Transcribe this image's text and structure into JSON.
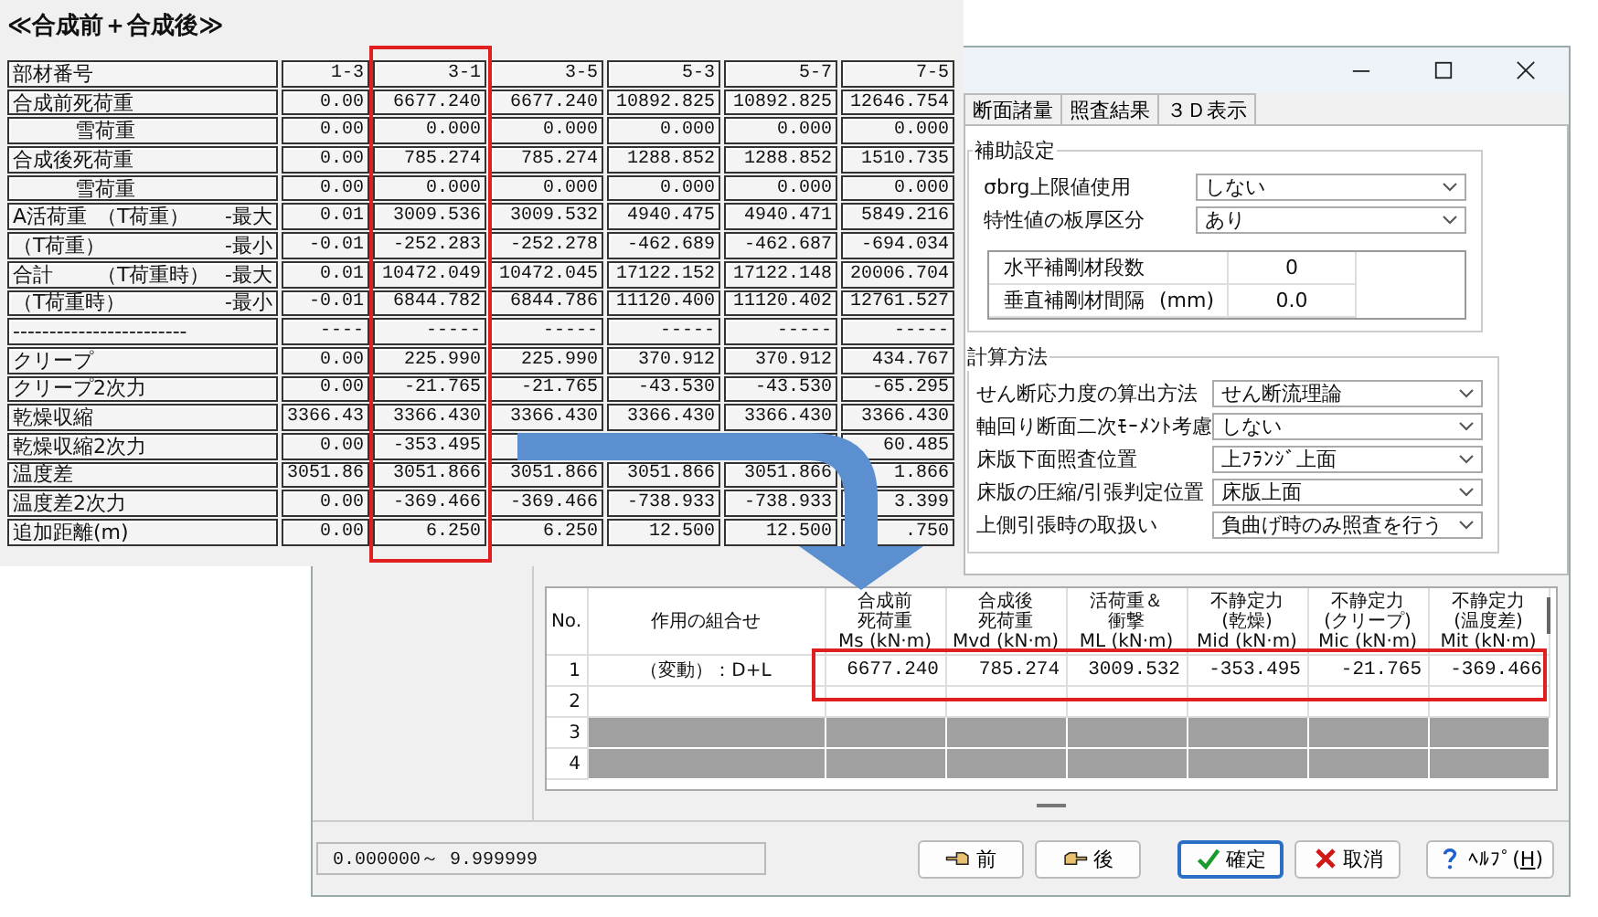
{
  "left_panel": {
    "title": "≪合成前＋合成後≫",
    "header_label": "部材番号",
    "columns": [
      "1-3",
      "3-1",
      "3-5",
      "5-3",
      "5-7",
      "7-5"
    ],
    "rows": [
      {
        "kind": "main",
        "label": "合成前死荷重",
        "values": [
          "0.00",
          "6677.240",
          "6677.240",
          "10892.825",
          "10892.825",
          "12646.754"
        ]
      },
      {
        "kind": "sub",
        "label": "雪荷重",
        "values": [
          "0.00",
          "0.000",
          "0.000",
          "0.000",
          "0.000",
          "0.000"
        ]
      },
      {
        "kind": "main",
        "label": "合成後死荷重",
        "values": [
          "0.00",
          "785.274",
          "785.274",
          "1288.852",
          "1288.852",
          "1510.735"
        ]
      },
      {
        "kind": "sub",
        "label": "雪荷重",
        "values": [
          "0.00",
          "0.000",
          "0.000",
          "0.000",
          "0.000",
          "0.000"
        ]
      },
      {
        "kind": "main",
        "label": "A活荷重",
        "load": "（T荷重）",
        "case": "-最大",
        "values": [
          "0.01",
          "3009.536",
          "3009.532",
          "4940.475",
          "4940.471",
          "5849.216"
        ]
      },
      {
        "kind": "main",
        "load": "（T荷重）",
        "case": "-最小",
        "values": [
          "-0.01",
          "-252.283",
          "-252.278",
          "-462.689",
          "-462.687",
          "-694.034"
        ]
      },
      {
        "kind": "main",
        "label": "合計",
        "load": "（T荷重時）",
        "case": "-最大",
        "values": [
          "0.01",
          "10472.049",
          "10472.045",
          "17122.152",
          "17122.148",
          "20006.704"
        ]
      },
      {
        "kind": "main",
        "load": "（T荷重時）",
        "case": "-最小",
        "values": [
          "-0.01",
          "6844.782",
          "6844.786",
          "11120.400",
          "11120.402",
          "12761.527"
        ]
      },
      {
        "kind": "main",
        "label": "------------------------",
        "values": [
          "----",
          "-----",
          "-----",
          "-----",
          "-----",
          "-----"
        ]
      },
      {
        "kind": "main",
        "label": "クリープ",
        "values": [
          "0.00",
          "225.990",
          "225.990",
          "370.912",
          "370.912",
          "434.767"
        ]
      },
      {
        "kind": "main",
        "label": "クリープ2次力",
        "values": [
          "0.00",
          "-21.765",
          "-21.765",
          "-43.530",
          "-43.530",
          "-65.295"
        ]
      },
      {
        "kind": "main",
        "label": "乾燥収縮",
        "values": [
          "3366.43",
          "3366.430",
          "3366.430",
          "3366.430",
          "3366.430",
          "3366.430"
        ]
      },
      {
        "kind": "main",
        "label": "乾燥収縮2次力",
        "values": [
          "0.00",
          "-353.495"
        ],
        "cut_value": "60.485"
      },
      {
        "kind": "main",
        "label": "温度差",
        "values": [
          "3051.86",
          "3051.866",
          "3051.866",
          "3051.866",
          "3051.866",
          "1.866"
        ]
      },
      {
        "kind": "main",
        "label": "温度差2次力",
        "values": [
          "0.00",
          "-369.466",
          "-369.466",
          "-738.933",
          "-738.933",
          "3.399"
        ]
      },
      {
        "kind": "main",
        "label": "追加距離(m)",
        "values": [
          "0.00",
          "6.250",
          "6.250",
          "12.500",
          "12.500",
          ".750"
        ]
      }
    ]
  },
  "dialog": {
    "tabs": [
      {
        "label": "断面諸量",
        "selected": false
      },
      {
        "label": "照査結果",
        "selected": false
      },
      {
        "label": "３Ｄ表示",
        "selected": false
      }
    ],
    "aux": {
      "title": "補助設定",
      "settings": [
        {
          "label": "σbrg上限値使用",
          "value": "しない"
        },
        {
          "label": "特性値の板厚区分",
          "value": "あり"
        }
      ],
      "params": [
        {
          "label": "水平補剛材段数",
          "value": "0"
        },
        {
          "label": "垂直補剛材間隔",
          "unit": "(mm)",
          "value": "0.0"
        }
      ]
    },
    "calc": {
      "title": "計算方法",
      "settings": [
        {
          "label": "せん断応力度の算出方法",
          "value": "せん断流理論"
        },
        {
          "label": "軸回り断面二次ﾓｰﾒﾝﾄ考慮",
          "value": "しない"
        },
        {
          "label": "床版下面照査位置",
          "value": "上ﾌﾗﾝｼﾞ上面"
        },
        {
          "label": "床版の圧縮/引張判定位置",
          "value": "床版上面"
        },
        {
          "label": "上側引張時の取扱い",
          "value": "負曲げ時のみ照査を行う"
        }
      ]
    },
    "results": {
      "columns": [
        [
          "No."
        ],
        [
          "作用の組合せ"
        ],
        [
          "合成前",
          "死荷重",
          "Ms (kN·m)"
        ],
        [
          "合成後",
          "死荷重",
          "Mvd (kN·m)"
        ],
        [
          "活荷重＆",
          "衝撃",
          "ML (kN·m)"
        ],
        [
          "不静定力",
          "(乾燥)",
          "Mid (kN·m)"
        ],
        [
          "不静定力",
          "(クリープ)",
          "Mic (kN·m)"
        ],
        [
          "不静定力",
          "(温度差)",
          "Mit (kN·m)"
        ]
      ],
      "rows": [
        {
          "no": "1",
          "disabled": false,
          "combo": "（変動）：D+L",
          "values": [
            "6677.240",
            "785.274",
            "3009.532",
            "-353.495",
            "-21.765",
            "-369.466"
          ]
        },
        {
          "no": "2",
          "disabled": false
        },
        {
          "no": "3",
          "disabled": true
        },
        {
          "no": "4",
          "disabled": true
        }
      ]
    },
    "status": "0.000000～ 9.999999",
    "buttons": [
      {
        "kind": "prev",
        "label": "前",
        "focused": false
      },
      {
        "kind": "next",
        "label": "後",
        "focused": false
      },
      {
        "kind": "ok",
        "label": "確定",
        "focused": true
      },
      {
        "kind": "cancel",
        "label": "取消",
        "focused": false
      },
      {
        "kind": "help",
        "label": "ﾍﾙﾌﾟ(",
        "accel": "H",
        "tail": ")",
        "focused": false
      }
    ]
  }
}
